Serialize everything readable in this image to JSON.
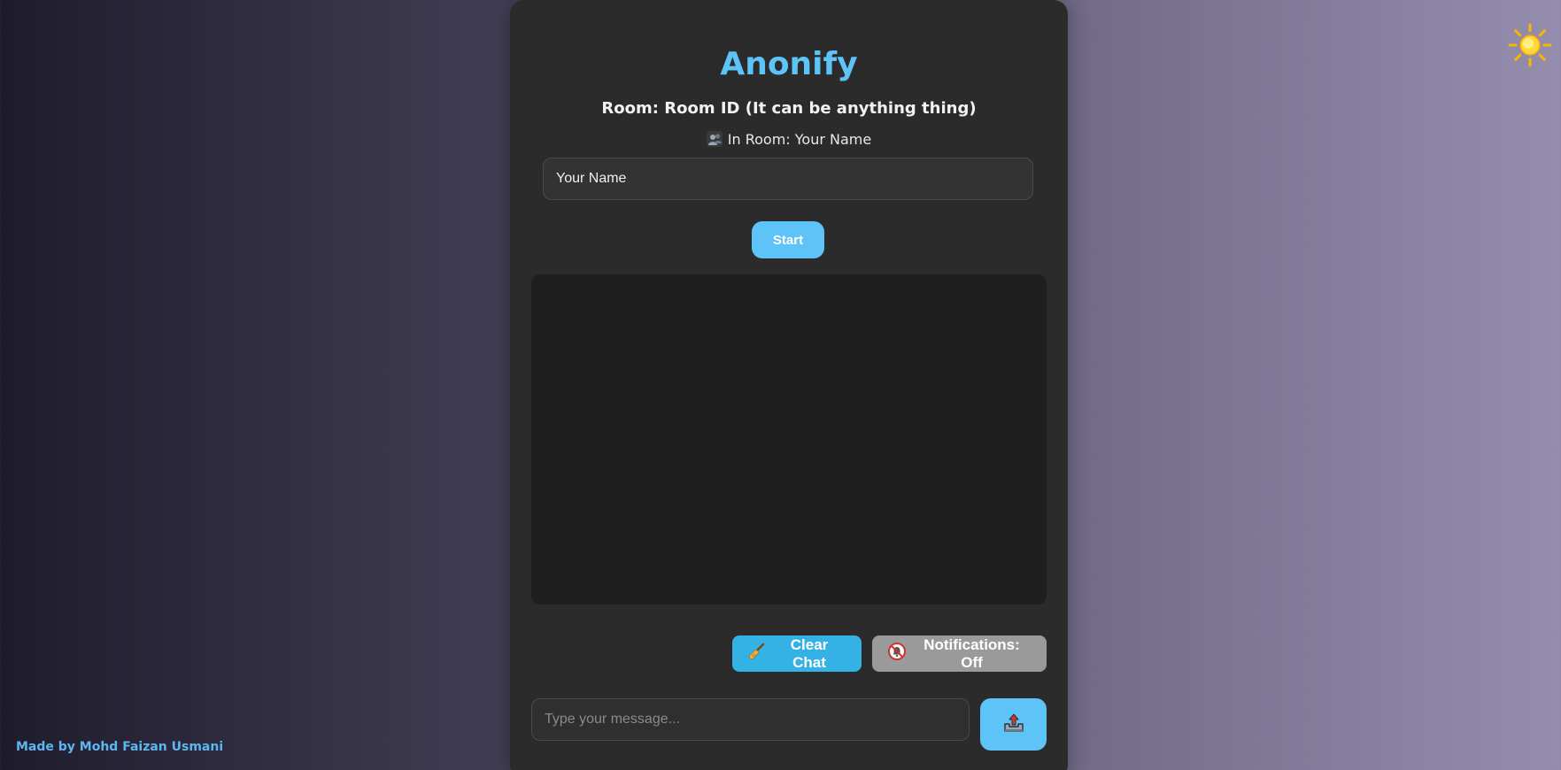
{
  "app": {
    "title": "Anonify",
    "room_line": "Room: Room ID (It can be anything thing)",
    "in_room_line": "In Room: Your Name"
  },
  "name_input": {
    "value": "Your Name",
    "placeholder": "Your Name"
  },
  "start_button": {
    "label": "Start"
  },
  "actions": {
    "clear_chat_label": "Clear Chat",
    "clear_chat_icon": "broom-icon",
    "notifications_label": "Notifications: Off",
    "notifications_icon": "bell-off-icon"
  },
  "message_input": {
    "value": "",
    "placeholder": "Type your message..."
  },
  "send_button": {
    "icon": "outbox-tray-icon"
  },
  "theme_toggle": {
    "icon": "sun-icon"
  },
  "footer": {
    "credit": "Made by Mohd Faizan Usmani"
  },
  "colors": {
    "accent": "#5ec3f7",
    "card": "#2b2b2b",
    "chat_area": "#1f1f1f",
    "clear_button": "#34b2e5",
    "notifications_button": "#9a9a9a",
    "credit": "#5eb6f0"
  }
}
